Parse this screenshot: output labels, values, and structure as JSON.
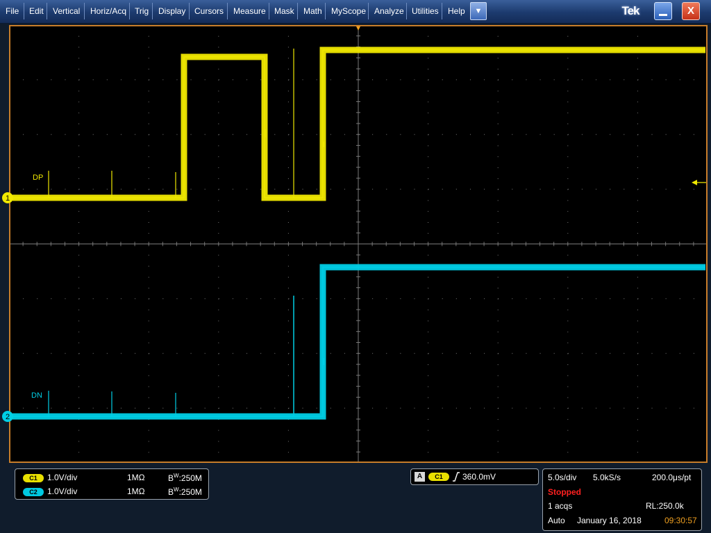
{
  "menu": {
    "items": [
      "File",
      "Edit",
      "Vertical",
      "Horiz/Acq",
      "Trig",
      "Display",
      "Cursors",
      "Measure",
      "Mask",
      "Math",
      "MyScope",
      "Analyze",
      "Utilities",
      "Help"
    ],
    "dropdown_icon": "chevron-down-icon",
    "brand": "Tek"
  },
  "window_controls": {
    "minimize_icon": "minimize-icon",
    "close_label": "X"
  },
  "colors": {
    "ch1": "#f0e800",
    "ch2": "#00cfe6",
    "graticule_border": "#c87d2a",
    "grid": "#8a8a8a",
    "stopped": "#ff2020",
    "time": "#f0a020"
  },
  "waveforms": {
    "ch1": {
      "label": "DP",
      "marker": "1"
    },
    "ch2": {
      "label": "DN",
      "marker": "2"
    }
  },
  "trigger_marker_icon": "trigger-position-icon",
  "trigger_level_icon": "trigger-level-arrow-icon",
  "channels": [
    {
      "badge": "C1",
      "scale": "1.0V/div",
      "impedance": "1MΩ",
      "bw_prefix": "B",
      "bw_sub": "W",
      "bw_value": ":250M"
    },
    {
      "badge": "C2",
      "scale": "1.0V/div",
      "impedance": "1MΩ",
      "bw_prefix": "B",
      "bw_sub": "W",
      "bw_value": ":250M"
    }
  ],
  "trigger": {
    "mode_letter": "A",
    "source": "C1",
    "slope_icon": "rising-edge-icon",
    "level": "360.0mV"
  },
  "acquisition": {
    "time_div": "5.0s/div",
    "sample_rate": "5.0kS/s",
    "per_point": "200.0μs/pt",
    "state": "Stopped",
    "acqs": "1 acqs",
    "record_length": "RL:250.0k",
    "trigger_mode": "Auto",
    "date": "January 16, 2018",
    "time": "09:30:57"
  }
}
